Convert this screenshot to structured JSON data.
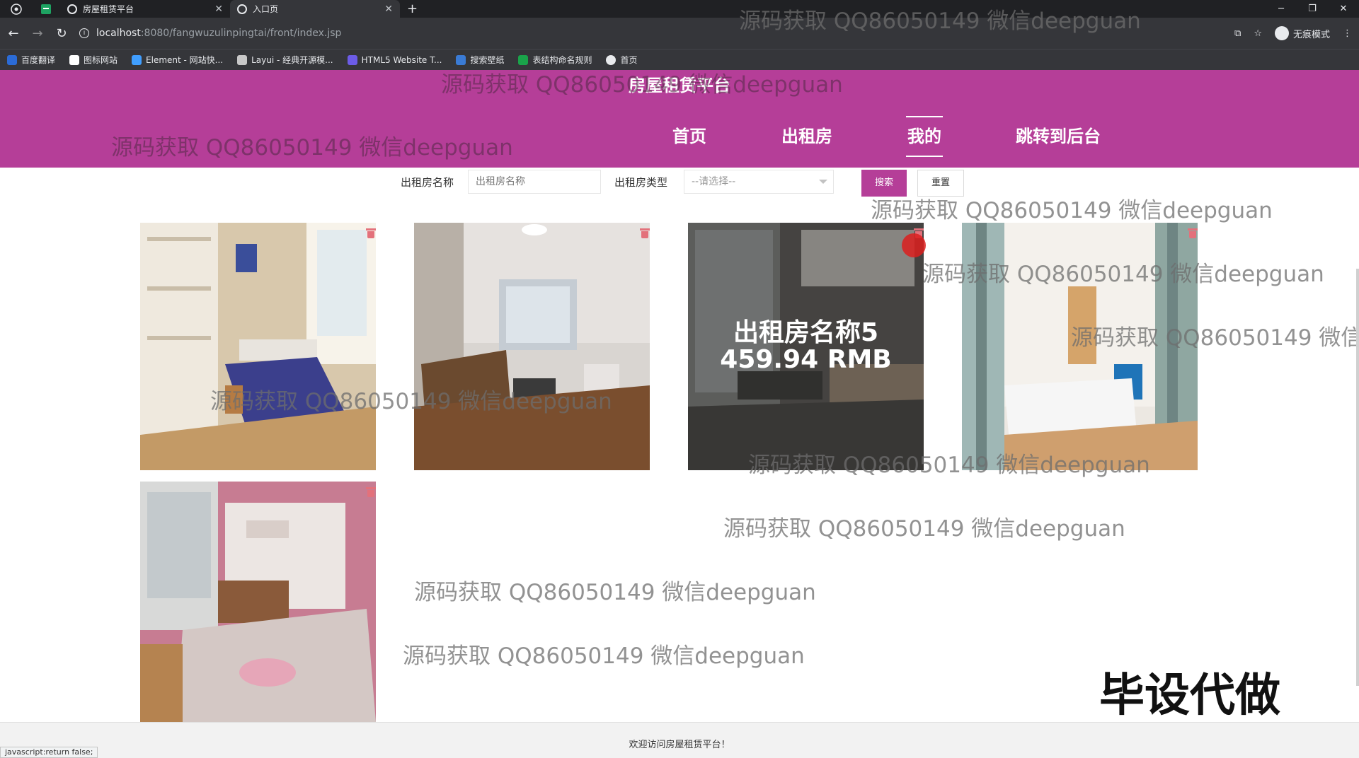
{
  "browser": {
    "tabs": [
      {
        "title": "房屋租赁平台"
      },
      {
        "title": "入口页"
      }
    ],
    "url_host": "localhost",
    "url_path": ":8080/fangwuzulinpingtai/front/index.jsp",
    "profile_label": "无痕模式",
    "bookmarks": [
      {
        "label": "百度翻译",
        "color": "#2b6bd6"
      },
      {
        "label": "图标网站",
        "color": "#ffffff"
      },
      {
        "label": "Element - 网站快...",
        "color": "#409eff"
      },
      {
        "label": "Layui - 经典开源模...",
        "color": "#c8c8c8"
      },
      {
        "label": "HTML5 Website T...",
        "color": "#6c5ce7"
      },
      {
        "label": "搜索壁纸",
        "color": "#3a7bd5"
      },
      {
        "label": "表结构命名规则",
        "color": "#1aa34a"
      },
      {
        "label": "首页",
        "color": "#e8eaed"
      }
    ],
    "status_text": "javascript:return false;"
  },
  "site": {
    "title": "房屋租赁平台",
    "nav": [
      {
        "label": "首页"
      },
      {
        "label": "出租房"
      },
      {
        "label": "我的"
      },
      {
        "label": "跳转到后台"
      }
    ]
  },
  "search": {
    "name_label": "出租房名称",
    "name_placeholder": "出租房名称",
    "type_label": "出租房类型",
    "type_selected": "--请选择--",
    "search_button": "搜索",
    "reset_button": "重置"
  },
  "listings": [
    {
      "theme": "bedroom-blue-bed"
    },
    {
      "theme": "living-room-window"
    },
    {
      "theme": "living-room-sofa",
      "hover_name": "出租房名称5",
      "hover_price": "459.94 RMB"
    },
    {
      "theme": "bedroom-curtain"
    },
    {
      "theme": "bedroom-pink-tropical"
    }
  ],
  "watermark_text": "源码获取 QQ86050149 微信deepguan",
  "stamp_text": "毕设代做",
  "footer": {
    "text": "欢迎访问房屋租赁平台！"
  },
  "colors": {
    "header": "#b53e98",
    "delete_icon": "#e3717b"
  }
}
